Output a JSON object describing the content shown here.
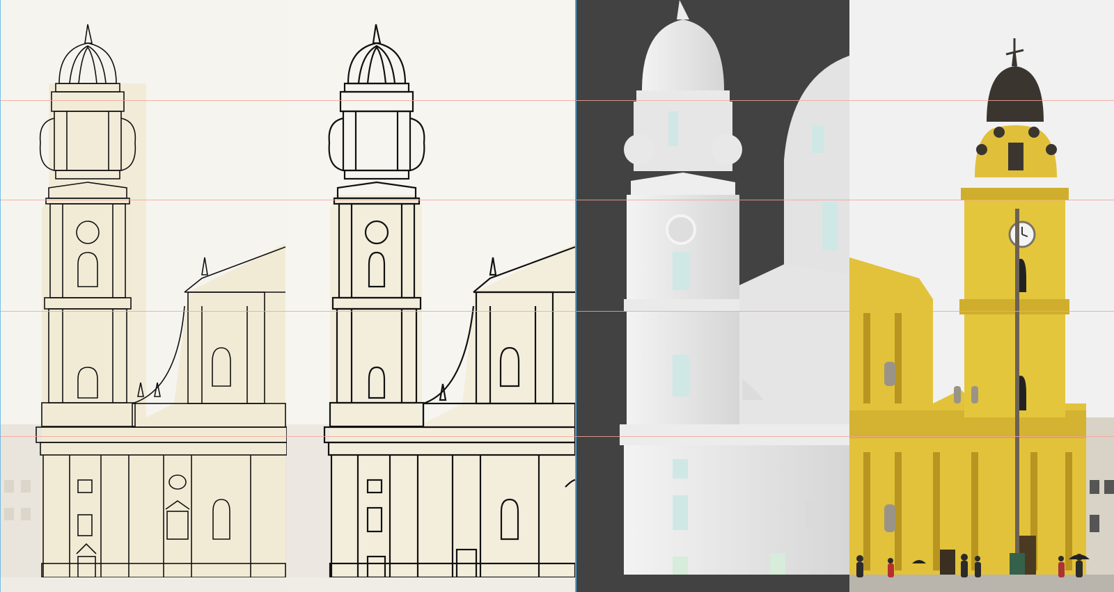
{
  "scene": {
    "panels": [
      {
        "name": "sketch-overlay-panel",
        "kind": "line-drawing-over-photo"
      },
      {
        "name": "line-drawing-panel",
        "kind": "line-drawing"
      },
      {
        "name": "white-3d-model-panel",
        "kind": "3d-clay-render"
      },
      {
        "name": "reference-photo-panel",
        "kind": "photo"
      }
    ],
    "colors": {
      "facade_yellow": "#e2c23a",
      "facade_shadow": "#b89521",
      "dome_dark": "#3b3530",
      "cream_fill": "#efe9d4",
      "line": "#111111",
      "model_white": "#e4e4e4",
      "model_bg": "#424242",
      "guide_red": "#f2a39a",
      "guide_blue": "#3fa9e3",
      "window_teal": "#cfe8e6"
    },
    "icons": [
      "clock-icon",
      "statue-icon",
      "weathervane-icon",
      "umbrella-icon",
      "person-icon",
      "lamp-post-icon"
    ]
  }
}
